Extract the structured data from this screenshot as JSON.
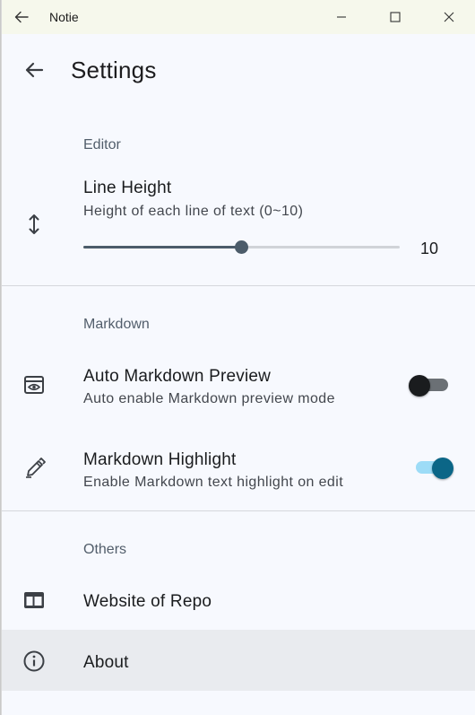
{
  "window": {
    "title": "Notie"
  },
  "titlebar": {
    "back_icon": "arrow-left-icon",
    "minimize_icon": "minimize-icon",
    "maximize_icon": "maximize-icon",
    "close_icon": "close-icon"
  },
  "appbar": {
    "title": "Settings",
    "back_icon": "arrow-left-icon"
  },
  "sections": {
    "editor": {
      "title": "Editor",
      "line_height": {
        "title": "Line Height",
        "subtitle": "Height of each line of text (0~10)",
        "icon": "vertical-resize-icon",
        "value": "10",
        "slider_fraction": 0.5
      }
    },
    "markdown": {
      "title": "Markdown",
      "auto_preview": {
        "title": "Auto Markdown Preview",
        "subtitle": "Auto enable Markdown preview mode",
        "icon": "preview-eye-icon",
        "enabled": false
      },
      "highlight": {
        "title": "Markdown Highlight",
        "subtitle": "Enable Markdown text highlight on edit",
        "icon": "pen-edit-icon",
        "enabled": true
      }
    },
    "others": {
      "title": "Others",
      "website": {
        "title": "Website of Repo",
        "icon": "web-window-icon"
      },
      "about": {
        "title": "About",
        "icon": "info-icon"
      }
    }
  },
  "colors": {
    "background": "#f7f9fe",
    "titlebar": "#f6f8ec",
    "slider_active": "#4c5c6a",
    "switch_on_track": "#9ddcf7",
    "switch_on_knob": "#0b6687",
    "about_highlight": "#e9ebef"
  }
}
